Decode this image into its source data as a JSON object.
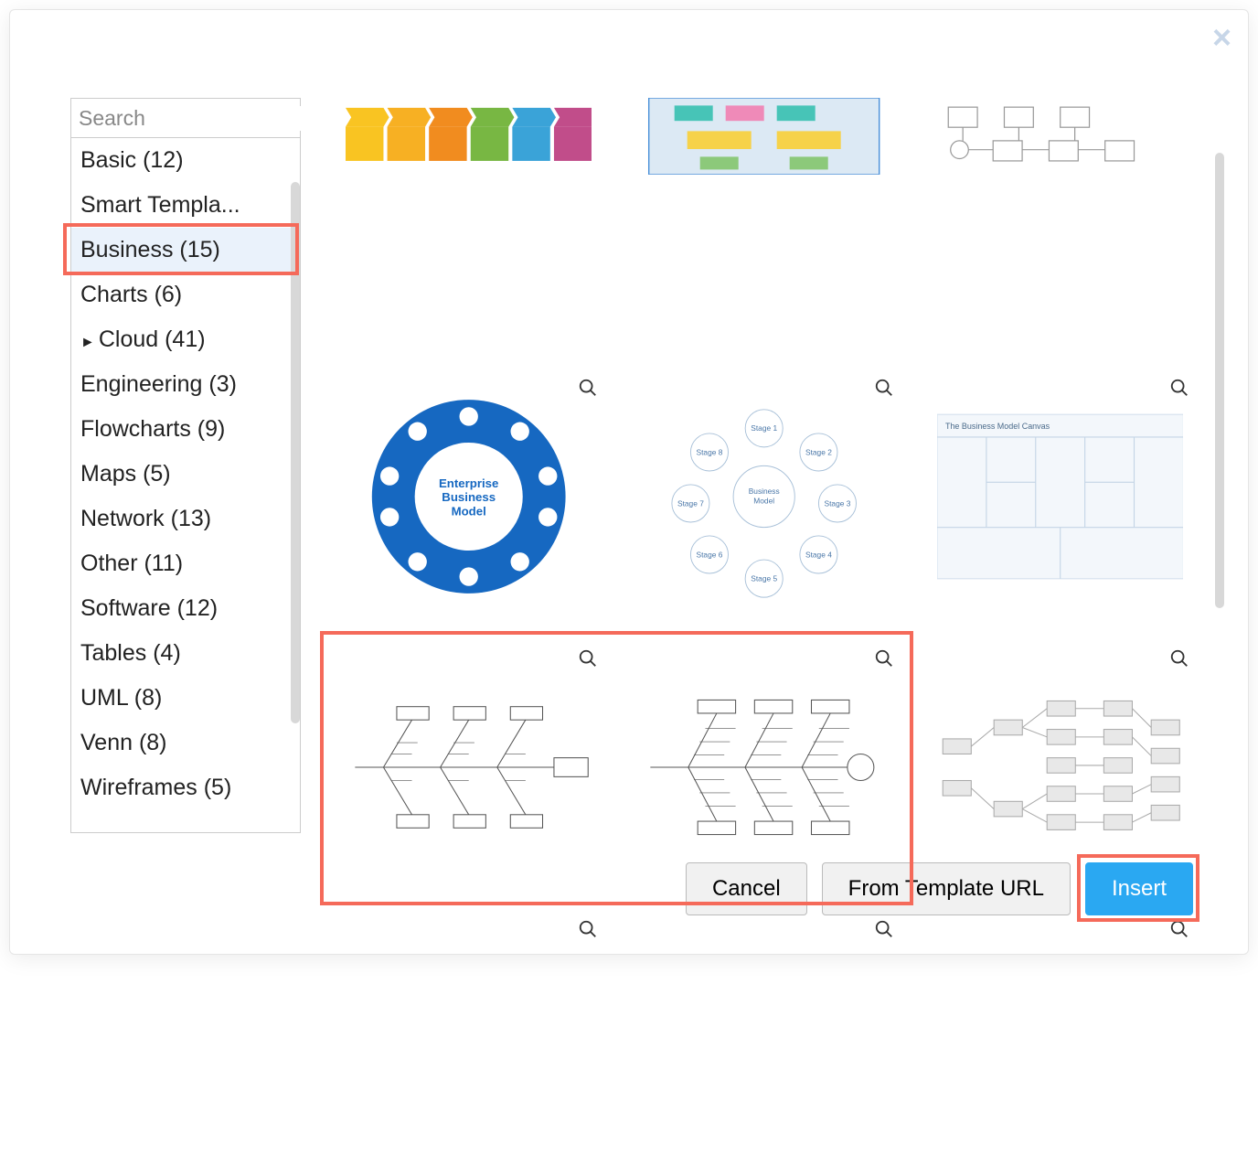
{
  "search": {
    "placeholder": "Search"
  },
  "categories": [
    {
      "label": "Basic (12)"
    },
    {
      "label": "Smart Templa..."
    },
    {
      "label": "Business (15)",
      "selected": true,
      "highlight": true
    },
    {
      "label": "Charts (6)"
    },
    {
      "label": "Cloud (41)",
      "expandable": true
    },
    {
      "label": "Engineering (3)"
    },
    {
      "label": "Flowcharts (9)"
    },
    {
      "label": "Maps (5)"
    },
    {
      "label": "Network (13)"
    },
    {
      "label": "Other (11)"
    },
    {
      "label": "Software (12)"
    },
    {
      "label": "Tables (4)"
    },
    {
      "label": "UML (8)"
    },
    {
      "label": "Venn (8)"
    },
    {
      "label": "Wireframes (5)"
    }
  ],
  "templates": {
    "row0": [
      {
        "name": "process-flow-partial"
      },
      {
        "name": "block-diagram-partial"
      },
      {
        "name": "bpmn-partial"
      }
    ],
    "row1": [
      {
        "name": "enterprise-business-model",
        "center_label": "Enterprise\nBusiness\nModel"
      },
      {
        "name": "business-model-stages",
        "center_label": "Business\nModel",
        "stage_prefix": "Stage"
      },
      {
        "name": "business-model-canvas",
        "title": "The Business Model Canvas"
      }
    ],
    "row2": [
      {
        "name": "fishbone-1"
      },
      {
        "name": "fishbone-2"
      },
      {
        "name": "network-tree"
      }
    ],
    "row3": [
      {
        "name": "t7"
      },
      {
        "name": "t8"
      },
      {
        "name": "t9"
      }
    ]
  },
  "buttons": {
    "cancel": "Cancel",
    "from_url": "From Template URL",
    "insert": "Insert"
  },
  "highlights": {
    "row2": true,
    "insert_button": true,
    "business_category": true
  }
}
